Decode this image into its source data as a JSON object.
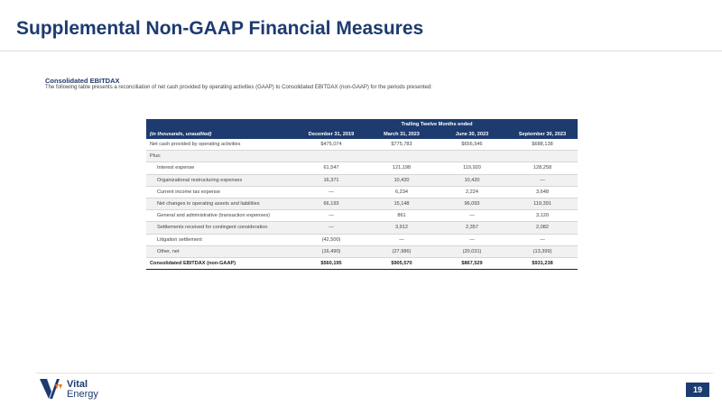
{
  "page": {
    "title": "Supplemental Non-GAAP Financial Measures",
    "section_heading": "Consolidated EBITDAX",
    "section_description": "The following table presents a reconciliation of net cash provided by operating activities (GAAP) to Consolidated EBITDAX (non-GAAP) for the periods presented:",
    "page_number": "19"
  },
  "table": {
    "band_label": "Trailing Twelve Months ended",
    "label_header": "(in thousands, unaudited)",
    "columns": [
      "December 31, 2019",
      "March 31, 2023",
      "June 30, 2023",
      "September 30, 2023"
    ],
    "rows": [
      {
        "label": "Net cash provided by operating activities",
        "values": [
          "$475,074",
          "$775,783",
          "$656,546",
          "$688,138"
        ]
      },
      {
        "label": "Plus:",
        "values": [
          "",
          "",
          "",
          ""
        ]
      },
      {
        "label": "Interest expense",
        "values": [
          "61,547",
          "121,198",
          "119,920",
          "128,258"
        ]
      },
      {
        "label": "Organizational restructuring expenses",
        "values": [
          "16,371",
          "10,420",
          "10,420",
          "—"
        ]
      },
      {
        "label": "Current income tax expense",
        "values": [
          "—",
          "6,234",
          "2,224",
          "3,648"
        ]
      },
      {
        "label": "Net changes in operating assets and liabilities",
        "values": [
          "66,193",
          "15,148",
          "96,093",
          "119,391"
        ]
      },
      {
        "label": "General and administrative (transaction expenses)",
        "values": [
          "—",
          "861",
          "—",
          "3,120"
        ]
      },
      {
        "label": "Settlements received for contingent consideration",
        "values": [
          "—",
          "3,912",
          "2,357",
          "2,082"
        ]
      },
      {
        "label": "Litigation settlement",
        "values": [
          "(42,500)",
          "—",
          "—",
          "—"
        ]
      },
      {
        "label": "Other, net",
        "values": [
          "(16,490)",
          "(27,986)",
          "(20,031)",
          "(13,399)"
        ]
      }
    ],
    "total": {
      "label": "Consolidated EBITDAX (non-GAAP)",
      "values": [
        "$560,195",
        "$905,570",
        "$867,529",
        "$931,238"
      ]
    }
  },
  "logo": {
    "word1": "Vital",
    "word2": "Energy"
  },
  "colors": {
    "brand_navy": "#1d3b6f",
    "brand_orange": "#e8731f",
    "row_shade": "#f1f1f1"
  }
}
